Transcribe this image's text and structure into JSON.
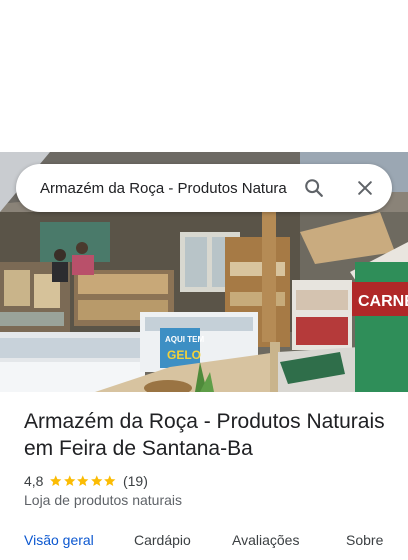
{
  "search": {
    "query": "Armazém da Roça - Produtos Natura",
    "search_icon": "search-icon",
    "close_icon": "close-icon"
  },
  "photo": {
    "sign_aqui_tem": "AQUI TEM",
    "sign_gelo": "GELO",
    "sign_carne": "CARNE"
  },
  "place": {
    "title": "Armazém da Roça - Produtos Naturais em Feira de Santana-Ba",
    "rating": "4,8",
    "rating_value": 4.8,
    "reviews": "(19)",
    "category": "Loja de produtos naturais"
  },
  "tabs": [
    {
      "label": "Visão geral",
      "active": true
    },
    {
      "label": "Cardápio",
      "active": false
    },
    {
      "label": "Avaliações",
      "active": false
    },
    {
      "label": "Sobre",
      "active": false
    }
  ],
  "colors": {
    "star": "#fbbc04",
    "tab_active": "#0b57d0"
  }
}
